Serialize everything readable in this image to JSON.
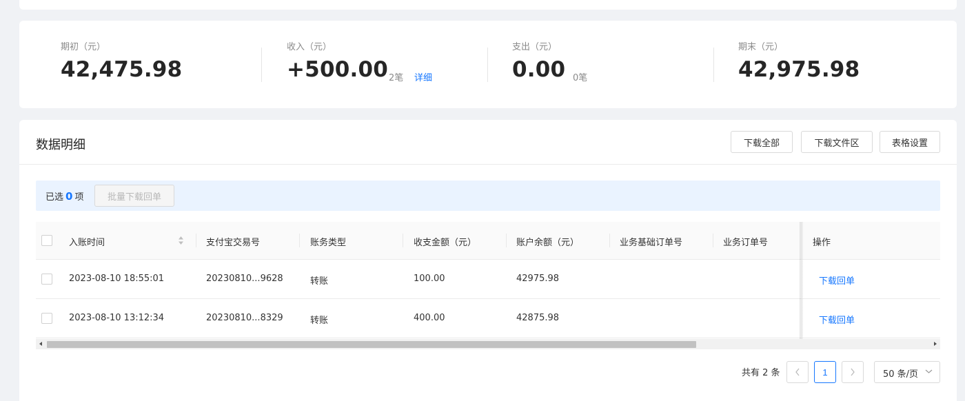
{
  "summary": {
    "opening": {
      "label": "期初（元）",
      "value": "42,475.98"
    },
    "income": {
      "label": "收入（元）",
      "value": "+500.00",
      "count": "2笔",
      "detail_link": "详细"
    },
    "expense": {
      "label": "支出（元）",
      "value": "0.00",
      "count": "0笔"
    },
    "closing": {
      "label": "期末（元）",
      "value": "42,975.98"
    }
  },
  "detail": {
    "title": "数据明细",
    "buttons": {
      "download_all": "下载全部",
      "download_area": "下载文件区",
      "table_settings": "表格设置"
    },
    "selection": {
      "prefix": "已选",
      "count": "0",
      "suffix": "项",
      "batch_button": "批量下载回单"
    },
    "columns": [
      "入账时间",
      "支付宝交易号",
      "账务类型",
      "收支金额（元）",
      "账户余额（元）",
      "业务基础订单号",
      "业务订单号",
      "操作"
    ],
    "rows": [
      {
        "time": "2023-08-10 18:55:01",
        "trade_no": "20230810...9628",
        "type": "转账",
        "amount": "100.00",
        "balance": "42975.98",
        "base_order": "",
        "order": "",
        "action": "下载回单"
      },
      {
        "time": "2023-08-10 13:12:34",
        "trade_no": "20230810...8329",
        "type": "转账",
        "amount": "400.00",
        "balance": "42875.98",
        "base_order": "",
        "order": "",
        "action": "下载回单"
      }
    ],
    "pagination": {
      "total": "共有 2 条",
      "current_page": "1",
      "page_size": "50 条/页"
    }
  }
}
